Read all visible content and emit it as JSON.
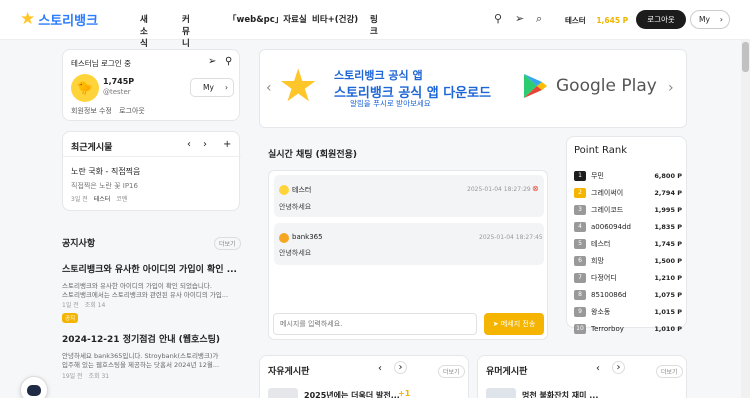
{
  "header": {
    "logo_text": "스토리뱅크",
    "nav": [
      "새소식",
      "커뮤니티",
      "「web&pc」자료실",
      "비타+(건강)",
      "링크"
    ],
    "user_name": "테스터",
    "points": "1,645 P",
    "logout_label": "로그아웃",
    "my_label": "My"
  },
  "profile": {
    "greeting": "테스터님 로그인 중",
    "points": "1,745P",
    "handle": "@tester",
    "my_label": "My",
    "edit_label": "회원정보 수정",
    "logout_label": "로그아웃"
  },
  "recent": {
    "title": "최근게시물",
    "item_title": "노란 국화 - 직접찍음",
    "item_desc": "직접찍은 노란 꽃 IP16",
    "item_meta": [
      "3일 전",
      "테스터",
      "코멘"
    ]
  },
  "notice": {
    "title": "공지사항",
    "more": "더보기",
    "items": [
      {
        "title": "스토리뱅크와 유사한 아이디의 가입이 확인 ...",
        "desc1": "스토리뱅크와 유사한 아이디의 가입이 확인 되었습니다.",
        "desc2": "스토리뱅크에서는 스토리뱅크와 관련된 유사 아이디의 가입...",
        "meta": [
          "1일 전",
          "조회 14"
        ],
        "tag": "공지"
      },
      {
        "title": "2024-12-21 정기점검 안내 (웹호스팅)",
        "desc1": "안녕하세요 bank365입니다. Stroybank(스토리뱅크)가",
        "desc2": "입주해 있는 웹호스팅을 제공하는 닷홈서 2024년 12월...",
        "meta": [
          "19일 전",
          "조회 31"
        ]
      }
    ]
  },
  "banner": {
    "line1": "스토리뱅크 공식 앱",
    "line2": "스토리뱅크 공식 앱 다운로드",
    "line3": "알림을 푸시로 받아보세요",
    "store": "Google Play"
  },
  "chat": {
    "title": "실시간 채팅 (회원전용)",
    "messages": [
      {
        "user": "테스터",
        "time": "2025-01-04 18:27:29",
        "text": "안녕하세요"
      },
      {
        "user": "bank365",
        "time": "2025-01-04 18:27:45",
        "text": "안녕하세요"
      }
    ],
    "placeholder": "메시지를 입력하세요.",
    "send_label": "메세지 전송"
  },
  "rank": {
    "title": "Point Rank",
    "rows": [
      {
        "n": "1",
        "name": "무민",
        "pts": "6,800 P"
      },
      {
        "n": "2",
        "name": "그레이써이",
        "pts": "2,794 P"
      },
      {
        "n": "3",
        "name": "그레이코드",
        "pts": "1,995 P"
      },
      {
        "n": "4",
        "name": "a006094dd",
        "pts": "1,835 P"
      },
      {
        "n": "5",
        "name": "테스터",
        "pts": "1,745 P"
      },
      {
        "n": "6",
        "name": "희망",
        "pts": "1,500 P"
      },
      {
        "n": "7",
        "name": "다정어디",
        "pts": "1,210 P"
      },
      {
        "n": "8",
        "name": "8510086d",
        "pts": "1,075 P"
      },
      {
        "n": "9",
        "name": "왕소동",
        "pts": "1,015 P"
      },
      {
        "n": "10",
        "name": "Terrorboy",
        "pts": "1,010 P"
      }
    ]
  },
  "free_board": {
    "title": "자유게시판",
    "more": "더보기",
    "first_item": "2025년에는 더욱더 발전...",
    "first_count": "+1"
  },
  "humor_board": {
    "title": "유머게시판",
    "more": "더보기",
    "first_item": "멍천 불화잔치 재미 ..."
  },
  "colors": {
    "accent": "#f5b400",
    "dark": "#1c1c1c",
    "blue": "#2b7cff",
    "page_bg": "#f6f7f9"
  }
}
